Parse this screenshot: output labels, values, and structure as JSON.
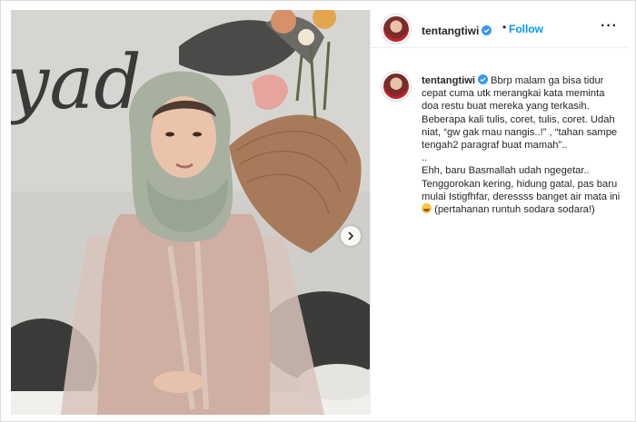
{
  "post": {
    "username": "tentangtiwi",
    "follow_label": "Follow",
    "separator": "•",
    "more_label": "···",
    "caption": {
      "username": "tentangtiwi",
      "lines": [
        "Bbrp malam ga bisa tidur cepat cuma utk merangkai kata meminta doa restu buat mereka yang terkasih.",
        "Beberapa kali tulis, coret, tulis, coret. Udah niat, “gw gak mau nangis..!” , “tahan sampe tengah2 paragraf buat mamah”..",
        "..",
        "Ehh, baru Basmallah udah ngegetar.. Tenggorokan kering, hidung gatal, pas baru mulai Istigfhfar, deressss banget air mata ini",
        "(pertahanan runtuh sodara sodara!)"
      ]
    },
    "photo_sign_text": "yad"
  },
  "colors": {
    "link_blue": "#0095f6",
    "verified_blue": "#3897f0",
    "border": "#dbdbdb"
  },
  "icons": {
    "verified": "verified-badge-icon",
    "next": "chevron-right-icon",
    "more": "more-options-icon",
    "emoji": "crying-laughing-emoji-icon"
  }
}
